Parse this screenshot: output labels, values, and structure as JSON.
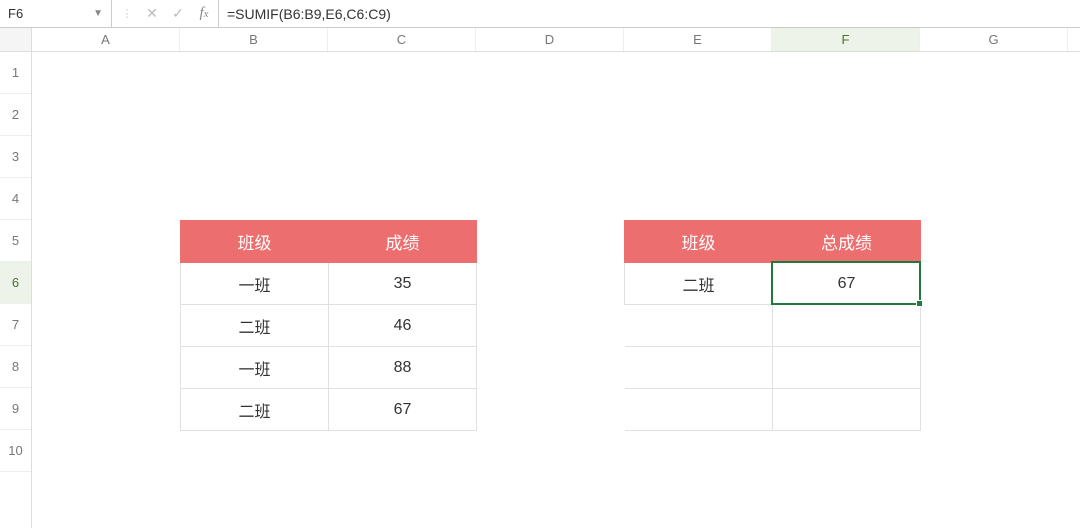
{
  "name_box": "F6",
  "formula": "=SUMIF(B6:B9,E6,C6:C9)",
  "columns": [
    "A",
    "B",
    "C",
    "D",
    "E",
    "F",
    "G"
  ],
  "rows": [
    "1",
    "2",
    "3",
    "4",
    "5",
    "6",
    "7",
    "8",
    "9",
    "10"
  ],
  "active_row": "6",
  "active_col": "F",
  "table1": {
    "headers": [
      "班级",
      "成绩"
    ],
    "rows": [
      {
        "class": "一班",
        "score": "35"
      },
      {
        "class": "二班",
        "score": "46"
      },
      {
        "class": "一班",
        "score": "88"
      },
      {
        "class": "二班",
        "score": "67"
      }
    ]
  },
  "table2": {
    "headers": [
      "班级",
      "总成绩"
    ],
    "rows": [
      {
        "class": "二班",
        "total": "67"
      }
    ],
    "empty_rows": 3
  },
  "chart_data": {
    "type": "table",
    "tables": [
      {
        "name": "source",
        "columns": [
          "班级",
          "成绩"
        ],
        "data": [
          [
            "一班",
            35
          ],
          [
            "二班",
            46
          ],
          [
            "一班",
            88
          ],
          [
            "二班",
            67
          ]
        ]
      },
      {
        "name": "result",
        "columns": [
          "班级",
          "总成绩"
        ],
        "data": [
          [
            "二班",
            67
          ]
        ]
      }
    ]
  },
  "selected_cell": {
    "col": 5,
    "row": 5
  }
}
